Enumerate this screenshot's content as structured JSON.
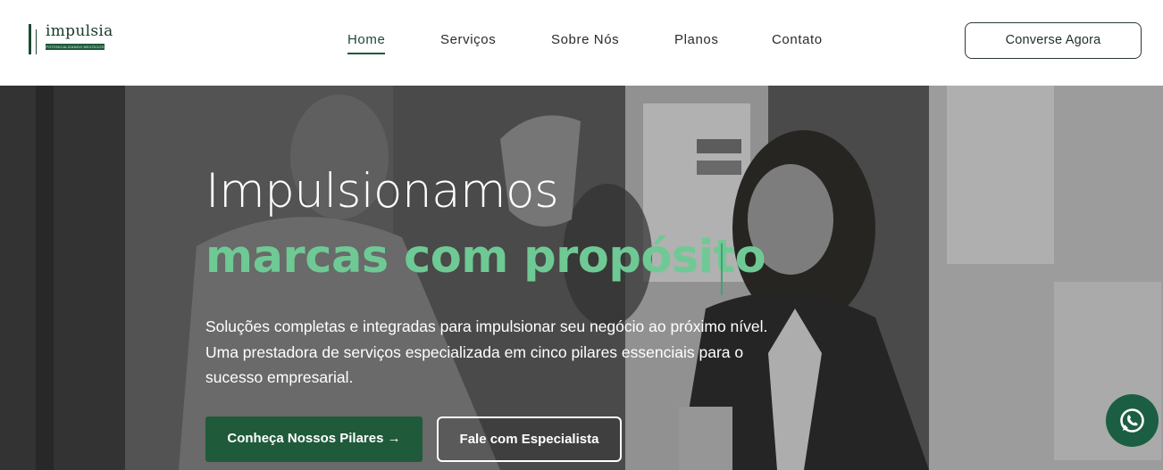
{
  "brand": {
    "name": "impulsia",
    "tagline": "POTENCIALIZANDO NEGÓCIOS",
    "color": "#1d4a34"
  },
  "nav": {
    "items": [
      {
        "label": "Home",
        "active": true
      },
      {
        "label": "Serviços",
        "active": false
      },
      {
        "label": "Sobre Nós",
        "active": false
      },
      {
        "label": "Planos",
        "active": false
      },
      {
        "label": "Contato",
        "active": false
      }
    ],
    "cta_label": "Converse Agora"
  },
  "hero": {
    "title_line1": "Impulsionamos",
    "title_line2": "marcas com propósito",
    "description": "Soluções completas e integradas para impulsionar seu negócio ao próximo nível. Uma prestadora de serviços especializada em cinco pilares essenciais para o sucesso empresarial.",
    "primary_button": "Conheça Nossos Pilares →",
    "secondary_button": "Fale com Especialista",
    "accent_color": "#6fc995"
  },
  "floating": {
    "whatsapp_icon": "whatsapp-icon"
  }
}
